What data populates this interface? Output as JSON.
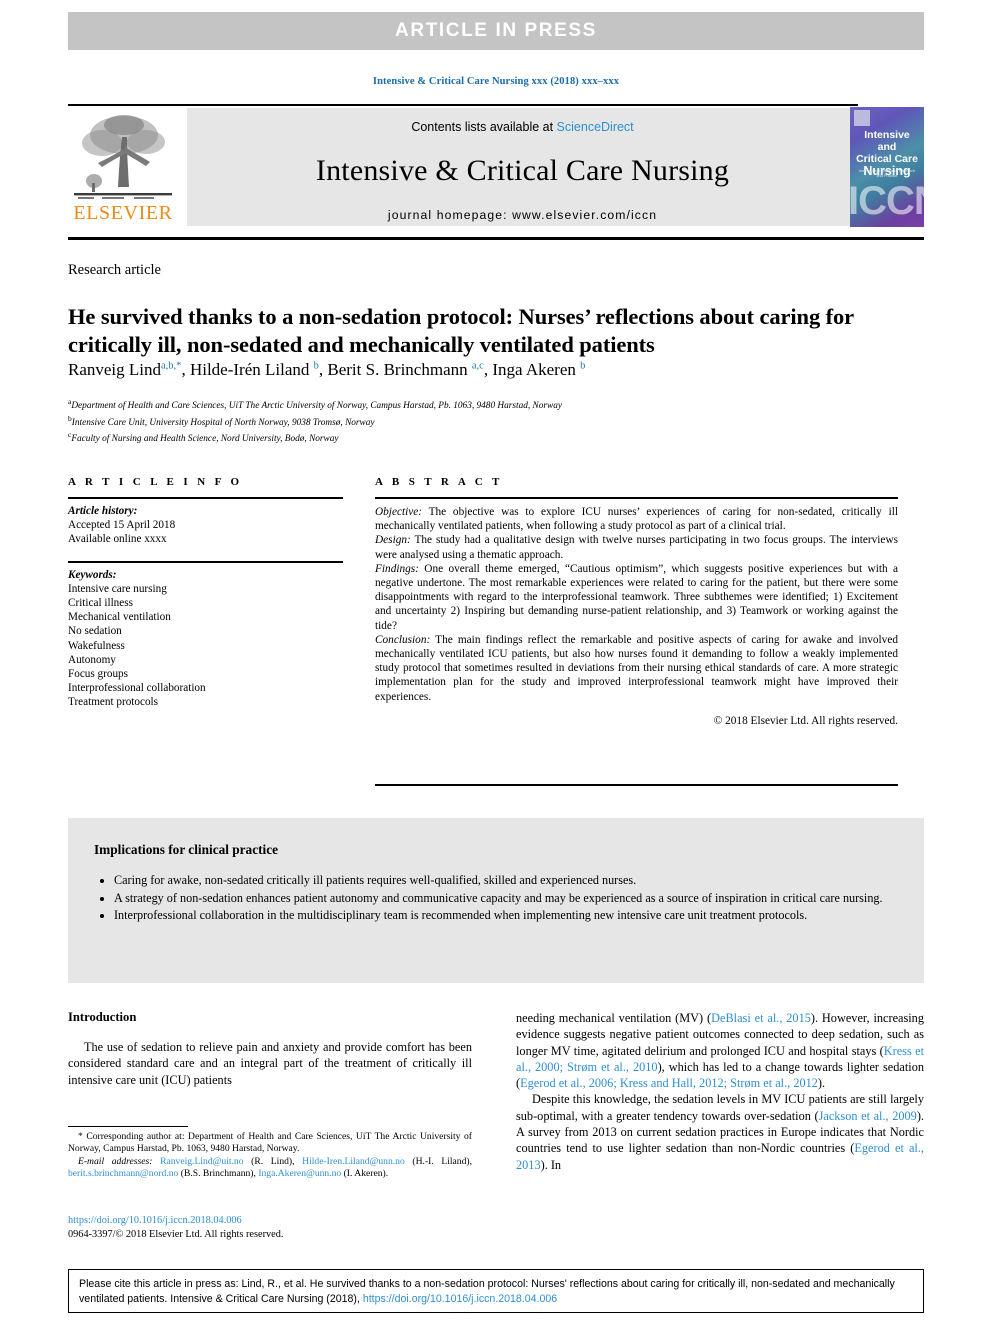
{
  "banner": {
    "text": "ARTICLE  IN  PRESS"
  },
  "running_head": "Intensive & Critical Care Nursing xxx (2018) xxx–xxx",
  "masthead": {
    "contents_prefix": "Contents lists available at ",
    "sciencedirect": "ScienceDirect",
    "journal_title": "Intensive & Critical Care Nursing",
    "homepage": "journal homepage: www.elsevier.com/iccn",
    "publisher": "ELSEVIER",
    "cover": {
      "line1": "Intensive and",
      "line2": "Critical Care",
      "line3": "Nursing",
      "subtitle": "International Journal of Research and Practice",
      "acronym": "ICCN"
    }
  },
  "article": {
    "kicker": "Research article",
    "title": "He survived thanks to a non-sedation protocol: Nurses’ reflections about caring for critically ill, non-sedated and mechanically ventilated patients",
    "authors": [
      {
        "name": "Ranveig Lind",
        "sup": "a,b,*"
      },
      {
        "name": "Hilde-Irén Liland",
        "sup": "b"
      },
      {
        "name": "Berit S. Brinchmann",
        "sup": "a,c"
      },
      {
        "name": "Inga Akeren",
        "sup": "b"
      }
    ],
    "affiliations": [
      {
        "mark": "a",
        "text": "Department of Health and Care Sciences, UiT The Arctic University of Norway, Campus Harstad, Pb. 1063, 9480 Harstad, Norway"
      },
      {
        "mark": "b",
        "text": "Intensive Care Unit, University Hospital of North Norway, 9038 Tromsø, Norway"
      },
      {
        "mark": "c",
        "text": "Faculty of Nursing and Health Science, Nord University, Bodø, Norway"
      }
    ]
  },
  "article_info": {
    "heading": "A R T I C L E   I N F O",
    "history_label": "Article history:",
    "history": [
      "Accepted 15 April 2018",
      "Available online xxxx"
    ],
    "keywords_label": "Keywords:",
    "keywords": [
      "Intensive care nursing",
      "Critical illness",
      "Mechanical ventilation",
      "No sedation",
      "Wakefulness",
      "Autonomy",
      "Focus groups",
      "Interprofessional collaboration",
      "Treatment protocols"
    ]
  },
  "abstract": {
    "heading": "A B S T R A C T",
    "sections": [
      {
        "label": "Objective:",
        "text": " The objective was to explore ICU nurses’ experiences of caring for non-sedated, critically ill mechanically ventilated patients, when following a study protocol as part of a clinical trial."
      },
      {
        "label": "Design:",
        "text": " The study had a qualitative design with twelve nurses participating in two focus groups. The interviews were analysed using a thematic approach."
      },
      {
        "label": "Findings:",
        "text": " One overall theme emerged, “Cautious optimism”, which suggests positive experiences but with a negative undertone. The most remarkable experiences were related to caring for the patient, but there were some disappointments with regard to the interprofessional teamwork. Three subthemes were identified; 1) Excitement and uncertainty 2) Inspiring but demanding nurse-patient relationship, and 3) Teamwork or working against the tide?"
      },
      {
        "label": "Conclusion:",
        "text": " The main findings reflect the remarkable and positive aspects of caring for awake and involved mechanically ventilated ICU patients, but also how nurses found it demanding to follow a weakly implemented study protocol that sometimes resulted in deviations from their nursing ethical standards of care. A more strategic implementation plan for the study and improved interprofessional teamwork might have improved their experiences."
      }
    ],
    "copyright": "© 2018 Elsevier Ltd. All rights reserved."
  },
  "implications": {
    "title": "Implications for clinical practice",
    "items": [
      "Caring for awake, non-sedated critically ill patients requires well-qualified, skilled and experienced nurses.",
      "A strategy of non-sedation enhances patient autonomy and communicative capacity and may be experienced as a source of inspiration in critical care nursing.",
      "Interprofessional collaboration in the multidisciplinary team is recommended when implementing new intensive care unit treatment protocols."
    ]
  },
  "body": {
    "intro_heading": "Introduction",
    "left_paragraph": "The use of sedation to relieve pain and anxiety and provide comfort has been considered standard care and an integral part of the treatment of critically ill intensive care unit (ICU) patients",
    "right_paragraph_1_a": "needing mechanical ventilation (MV) (",
    "right_cite_1": "DeBlasi et al., 2015",
    "right_paragraph_1_b": "). However, increasing evidence suggests negative patient outcomes connected to deep sedation, such as longer MV time, agitated delirium and prolonged ICU and hospital stays (",
    "right_cite_2": "Kress et al., 2000; Strøm et al., 2010",
    "right_paragraph_1_c": "), which has led to a change towards lighter sedation (",
    "right_cite_3": "Egerod et al., 2006; Kress and Hall, 2012; Strøm et al., 2012",
    "right_paragraph_1_d": ").",
    "right_paragraph_2_a": "Despite this knowledge, the sedation levels in MV ICU patients are still largely sub-optimal, with a greater tendency towards over-sedation (",
    "right_cite_4": "Jackson et al., 2009",
    "right_paragraph_2_b": "). A survey from 2013 on current sedation practices in Europe indicates that Nordic countries tend to use lighter sedation than non-Nordic countries (",
    "right_cite_5": "Egerod et al., 2013",
    "right_paragraph_2_c": "). In"
  },
  "footnotes": {
    "corresponding": "* Corresponding author at: Department of Health and Care Sciences, UiT The Arctic University of Norway, Campus Harstad, Pb. 1063, 9480 Harstad, Norway.",
    "email_label": "E-mail addresses:",
    "emails": [
      {
        "address": "Ranveig.Lind@uit.no",
        "person": " (R. Lind), "
      },
      {
        "address": "Hilde-Iren.Liland@unn.no",
        "person": " (H.-I. Liland), "
      },
      {
        "address": "berit.s.brinchmann@nord.no",
        "person": " (B.S. Brinchmann), "
      },
      {
        "address": "Inga.Akeren@unn.no",
        "person": " (I. Akeren)."
      }
    ],
    "doi": "https://doi.org/10.1016/j.iccn.2018.04.006",
    "issn_line": "0964-3397/© 2018 Elsevier Ltd. All rights reserved."
  },
  "citation": {
    "text_before": "Please cite this article in press as: Lind, R., et al. He survived thanks to a non-sedation protocol: Nurses' reflections about caring for critically ill, non-sedated and mechanically ventilated patients. Intensive & Critical Care Nursing (2018), ",
    "doi": "https://doi.org/10.1016/j.iccn.2018.04.006"
  }
}
